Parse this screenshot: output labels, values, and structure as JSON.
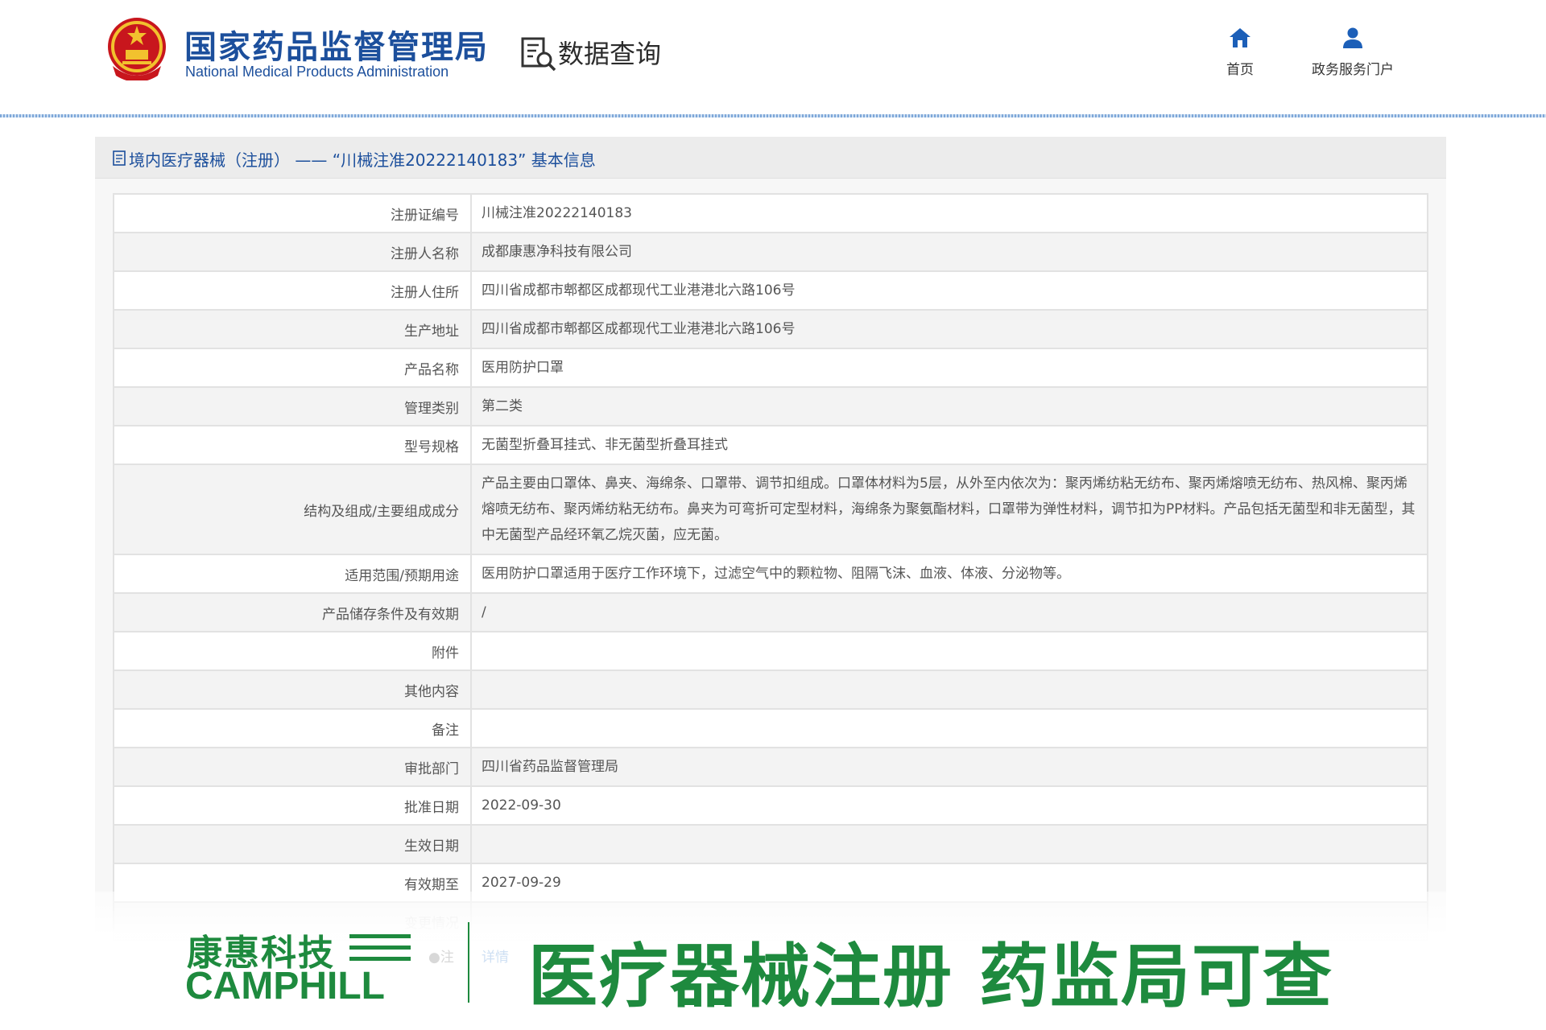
{
  "header": {
    "site_title_cn": "国家药品监督管理局",
    "site_title_en": "National Medical Products Administration",
    "section_label": "数据查询",
    "nav": [
      {
        "label": "首页",
        "icon": "home-icon"
      },
      {
        "label": "政务服务门户",
        "icon": "user-icon"
      }
    ]
  },
  "panel": {
    "title": "境内医疗器械（注册） —— “川械注准20222140183” 基本信息",
    "rows": [
      {
        "key": "注册证编号",
        "value": "川械注准20222140183"
      },
      {
        "key": "注册人名称",
        "value": "成都康惠净科技有限公司"
      },
      {
        "key": "注册人住所",
        "value": "四川省成都市郫都区成都现代工业港港北六路106号"
      },
      {
        "key": "生产地址",
        "value": "四川省成都市郫都区成都现代工业港港北六路106号"
      },
      {
        "key": "产品名称",
        "value": "医用防护口罩"
      },
      {
        "key": "管理类别",
        "value": "第二类"
      },
      {
        "key": "型号规格",
        "value": "无菌型折叠耳挂式、非无菌型折叠耳挂式"
      },
      {
        "key": "结构及组成/主要组成成分",
        "value": "产品主要由口罩体、鼻夹、海绵条、口罩带、调节扣组成。口罩体材料为5层，从外至内依次为：聚丙烯纺粘无纺布、聚丙烯熔喷无纺布、热风棉、聚丙烯熔喷无纺布、聚丙烯纺粘无纺布。鼻夹为可弯折可定型材料，海绵条为聚氨酯材料，口罩带为弹性材料，调节扣为PP材料。产品包括无菌型和非无菌型，其中无菌型产品经环氧乙烷灭菌，应无菌。"
      },
      {
        "key": "适用范围/预期用途",
        "value": "医用防护口罩适用于医疗工作环境下，过滤空气中的颗粒物、阻隔飞沫、血液、体液、分泌物等。"
      },
      {
        "key": "产品储存条件及有效期",
        "value": "/"
      },
      {
        "key": "附件",
        "value": ""
      },
      {
        "key": "其他内容",
        "value": ""
      },
      {
        "key": "备注",
        "value": ""
      },
      {
        "key": "审批部门",
        "value": "四川省药品监督管理局"
      },
      {
        "key": "批准日期",
        "value": "2022-09-30"
      },
      {
        "key": "生效日期",
        "value": ""
      },
      {
        "key": "有效期至",
        "value": "2027-09-29"
      },
      {
        "key": "变更情况",
        "value": ""
      }
    ],
    "note_label": "注",
    "detail_link": "详情"
  },
  "banner": {
    "brand_cn": "康惠科技",
    "brand_en": "CAMPHILL",
    "slogan": "医疗器械注册 药监局可查"
  },
  "colors": {
    "brand_blue": "#1c4f9c",
    "brand_green": "#1e8a3e"
  }
}
